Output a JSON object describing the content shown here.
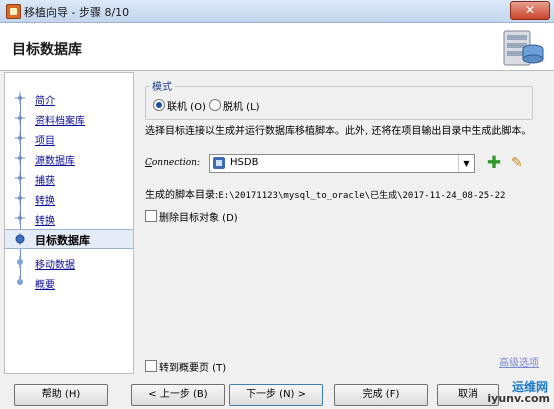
{
  "window": {
    "title": "移植向导 - 步骤 8/10",
    "close_label": "✕"
  },
  "header": {
    "title": "目标数据库"
  },
  "steps": [
    {
      "label": "简介",
      "state": "done"
    },
    {
      "label": "资料档案库",
      "state": "done"
    },
    {
      "label": "项目",
      "state": "done"
    },
    {
      "label": "源数据库",
      "state": "done"
    },
    {
      "label": "捕获",
      "state": "done"
    },
    {
      "label": "转换",
      "state": "done"
    },
    {
      "label": "转换",
      "state": "done"
    },
    {
      "label": "目标数据库",
      "state": "current"
    },
    {
      "label": "移动数据",
      "state": "future"
    },
    {
      "label": "概要",
      "state": "future"
    }
  ],
  "mode": {
    "legend": "模式",
    "online_label": "联机 (O)",
    "offline_label": "脱机 (L)",
    "selected": "online"
  },
  "description": "选择目标连接以生成并运行数据库移植脚本。此外, 还将在项目输出目录中生成此脚本。",
  "connection": {
    "label_prefix": "C",
    "label_rest": "onnection:",
    "value": "HSDB"
  },
  "script_dir": {
    "label": "生成的脚本目录:",
    "path": "E:\\20171123\\mysql_to_oracle\\已生成\\2017-11-24_08-25-22"
  },
  "drop_target_label": "删除目标对象 (D)",
  "goto_summary_label": "转到概要页 (T)",
  "advanced_link": "高级选项",
  "buttons": {
    "help": "帮助 (H)",
    "back": "< 上一步 (B)",
    "next": "下一步 (N) >",
    "finish": "完成 (F)",
    "cancel": "取消"
  },
  "watermark": {
    "line1": "运维网",
    "line2": "iyunv.com"
  },
  "colors": {
    "link": "#0c0c9a",
    "accent": "#1e4ea8",
    "add_icon": "#2e9a2e"
  }
}
